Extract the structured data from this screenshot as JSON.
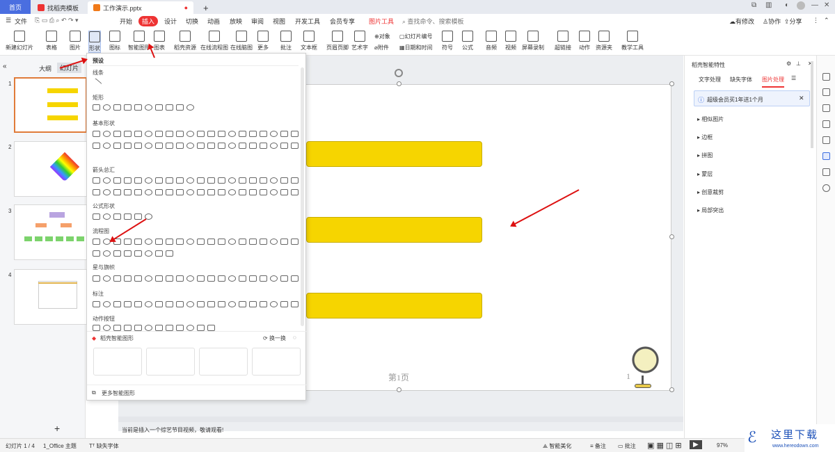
{
  "tabs": {
    "home": "首页",
    "template": "找稻壳模板",
    "doc": "工作演示.pptx",
    "new_tab": "+"
  },
  "window": {
    "ctl1": "⧉",
    "ctl2": "▥",
    "min": "—",
    "max": "□",
    "close": "✕"
  },
  "menu": {
    "file": "文件",
    "start": "开始",
    "insert": "插入",
    "design": "设计",
    "transition": "切换",
    "animation": "动画",
    "slideshow": "放映",
    "review": "审阅",
    "view": "视图",
    "dev": "开发工具",
    "member": "会员专享",
    "pictools": "图片工具",
    "search": "查找命令、搜索模板",
    "modify": "有修改",
    "collab": "协作",
    "share": "分享"
  },
  "ribbon": [
    {
      "label": "新建幻灯片"
    },
    {
      "label": "表格"
    },
    {
      "label": "图片"
    },
    {
      "label": "形状"
    },
    {
      "label": "图标"
    },
    {
      "label": "智能图形"
    },
    {
      "label": "图表"
    },
    {
      "label": "稻壳资源"
    },
    {
      "label": "在线流程图"
    },
    {
      "label": "在线脑图"
    },
    {
      "label": "更多"
    },
    {
      "label": "批注"
    },
    {
      "label": "文本框"
    },
    {
      "label": "页眉页脚"
    },
    {
      "label": "艺术字"
    },
    {
      "label": "符号"
    },
    {
      "label": "公式"
    },
    {
      "label": "音频"
    },
    {
      "label": "视频"
    },
    {
      "label": "屏幕录制"
    },
    {
      "label": "超链接"
    },
    {
      "label": "动作"
    },
    {
      "label": "资源夹"
    },
    {
      "label": "教学工具"
    }
  ],
  "ribbon_small": {
    "object": "对象",
    "slide_no": "幻灯片编号",
    "attach": "附件",
    "datetime": "日期和时间"
  },
  "left": {
    "outline": "大纲",
    "slides": "幻灯片",
    "add": "+"
  },
  "slides": [
    {
      "num": "1"
    },
    {
      "num": "2"
    },
    {
      "num": "3"
    },
    {
      "num": "4"
    }
  ],
  "shapes": {
    "preset": "预设",
    "lines": "线条",
    "rect": "矩形",
    "basic": "基本形状",
    "arrows": "箭头总汇",
    "formula": "公式形状",
    "flow": "流程图",
    "stars": "星与旗帜",
    "callout": "标注",
    "action": "动作按钮",
    "smart_title": "稻壳智能图形",
    "swap": "换一换",
    "more_smart": "更多智能图形"
  },
  "slide": {
    "page_label": "第1页",
    "page_num": "1"
  },
  "hint": "当前是插入一个综艺节目视频，敬请观看!",
  "right": {
    "title": "稻壳智能特性",
    "tabs": [
      "文字处理",
      "缺失字体",
      "图片处理"
    ],
    "promo": "超级会员买1年送1个月",
    "items": [
      "相似图片",
      "边框",
      "拼图",
      "蒙层",
      "创意裁剪",
      "局部突出"
    ]
  },
  "status": {
    "slide": "幻灯片 1 / 4",
    "theme": "1_Office 主题",
    "font": "缺失字体",
    "beautify": "智能美化",
    "notes": "备注",
    "comment": "批注",
    "zoom": "97%"
  },
  "watermark": {
    "cn": "这里下载",
    "url": "www.hereodown.com"
  },
  "colors": {
    "accent": "#4a6ee0",
    "insert": "#ee3333",
    "bar": "#f6d500",
    "arrow": "#dd1111"
  }
}
